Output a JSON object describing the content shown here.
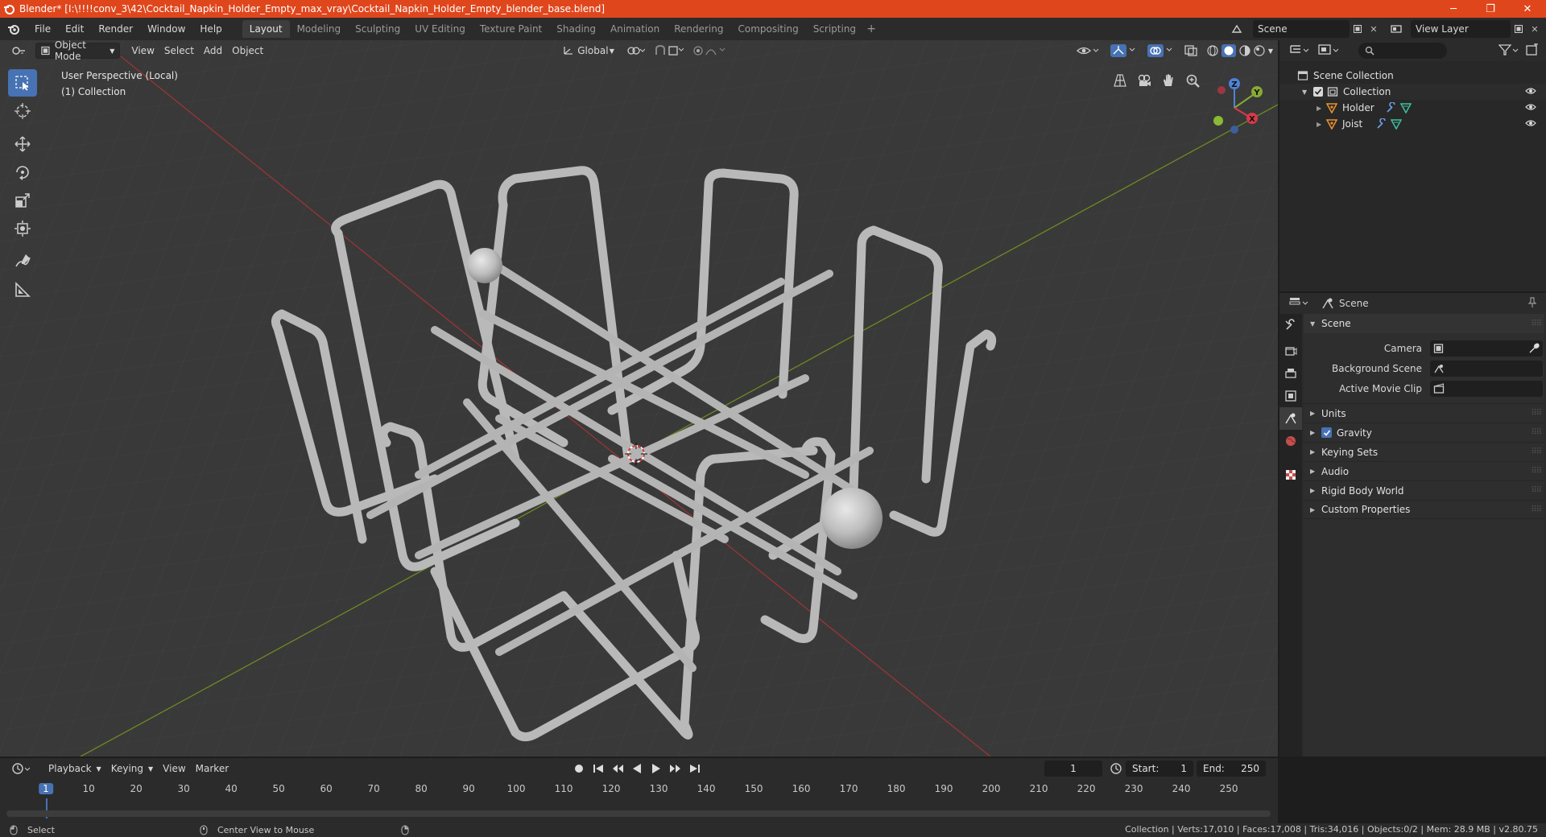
{
  "window": {
    "title": "Blender* [I:\\!!!!conv_3\\42\\Cocktail_Napkin_Holder_Empty_max_vray\\Cocktail_Napkin_Holder_Empty_blender_base.blend]",
    "minimize": "─",
    "maximize": "❐",
    "close": "✕"
  },
  "menu": {
    "file": "File",
    "edit": "Edit",
    "render": "Render",
    "window": "Window",
    "help": "Help"
  },
  "workspaces": [
    {
      "label": "Layout"
    },
    {
      "label": "Modeling"
    },
    {
      "label": "Sculpting"
    },
    {
      "label": "UV Editing"
    },
    {
      "label": "Texture Paint"
    },
    {
      "label": "Shading"
    },
    {
      "label": "Animation"
    },
    {
      "label": "Rendering"
    },
    {
      "label": "Compositing"
    },
    {
      "label": "Scripting"
    }
  ],
  "workspace_add": "+",
  "scene_selector": {
    "value": "Scene"
  },
  "view_layer_selector": {
    "value": "View Layer"
  },
  "viewport": {
    "mode": "Object Mode",
    "menus": {
      "view": "View",
      "select": "Select",
      "add": "Add",
      "object": "Object"
    },
    "orientation": "Global",
    "info_line1": "User Perspective (Local)",
    "info_line2": "(1) Collection",
    "gizmo": {
      "x": "X",
      "y": "Y",
      "z": "Z"
    }
  },
  "outliner": {
    "scene_collection": "Scene Collection",
    "collection": "Collection",
    "objects": [
      {
        "name": "Holder"
      },
      {
        "name": "Joist"
      }
    ]
  },
  "properties": {
    "header_title": "Scene",
    "panel_title": "Scene",
    "camera_label": "Camera",
    "background_scene_label": "Background Scene",
    "active_movie_clip_label": "Active Movie Clip",
    "subpanels": {
      "units": "Units",
      "gravity": "Gravity",
      "keying_sets": "Keying Sets",
      "audio": "Audio",
      "rigid_body_world": "Rigid Body World",
      "custom_properties": "Custom Properties"
    },
    "gravity_enabled": true
  },
  "timeline": {
    "menus": {
      "playback": "Playback",
      "keying": "Keying",
      "view": "View",
      "marker": "Marker"
    },
    "current_frame": "1",
    "start_label": "Start:",
    "start_value": "1",
    "end_label": "End:",
    "end_value": "250",
    "ruler": [
      "1",
      "10",
      "20",
      "30",
      "40",
      "50",
      "60",
      "70",
      "80",
      "90",
      "100",
      "110",
      "120",
      "130",
      "140",
      "150",
      "160",
      "170",
      "180",
      "190",
      "200",
      "210",
      "220",
      "230",
      "240",
      "250"
    ]
  },
  "statusbar": {
    "select": "Select",
    "center_view": "Center View to Mouse",
    "stats": "Collection | Verts:17,010 | Faces:17,008 | Tris:34,016 | Objects:0/2 | Mem: 28.9 MB | v2.80.75"
  },
  "colors": {
    "titlebar": "#e0461c",
    "accent": "#4772b3",
    "viewport_bg": "#393939",
    "axis_x": "#c83a3a",
    "axis_y": "#7a9a2a",
    "object_orange": "#e7902f",
    "mesh_gray": "#b9b9b9"
  }
}
